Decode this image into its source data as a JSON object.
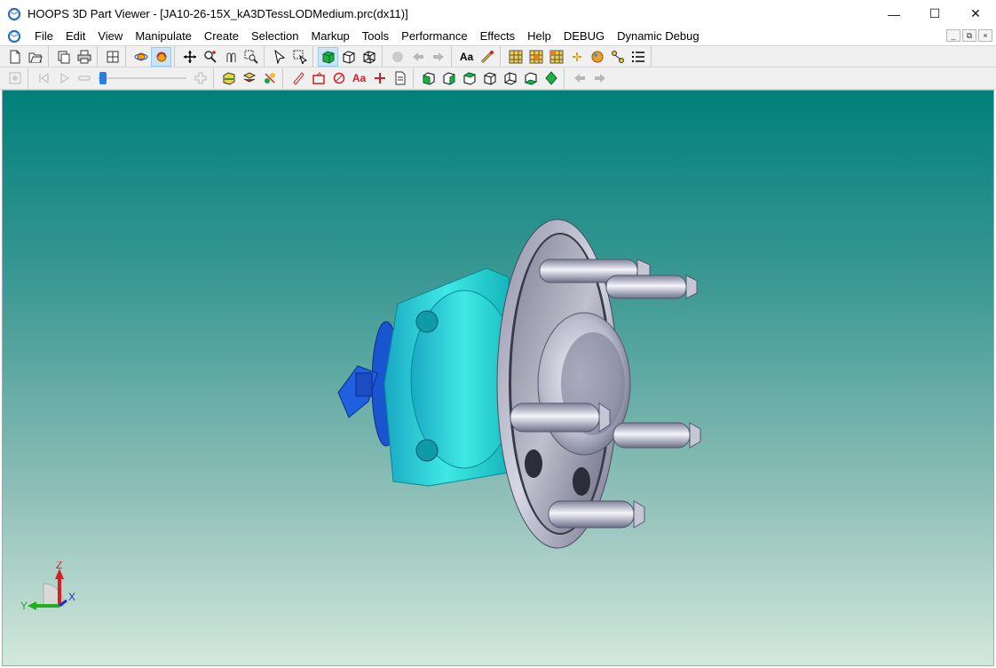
{
  "window": {
    "title": "HOOPS 3D Part Viewer - [JA10-26-15X_kA3DTessLODMedium.prc(dx11)]",
    "controls": [
      "—",
      "☐",
      "✕"
    ]
  },
  "menu": {
    "items": [
      "File",
      "Edit",
      "View",
      "Manipulate",
      "Create",
      "Selection",
      "Markup",
      "Tools",
      "Performance",
      "Effects",
      "Help",
      "DEBUG",
      "Dynamic Debug"
    ],
    "mdi_controls": [
      "_",
      "⧉",
      "×"
    ]
  },
  "toolbar": {
    "text_button": "Aa",
    "markup_text_button": "Aa",
    "animation_slider_value": 0.02
  },
  "triad": {
    "z_label": "Z",
    "x_label": "X",
    "y_label": "Y"
  },
  "colors": {
    "viewport_top": "#00807a",
    "viewport_bottom": "#d3e8dd",
    "part_cyan": "#19d6d6",
    "part_flange": "#a5a7b8",
    "axis_z": "#d42020",
    "axis_y": "#20b020",
    "axis_x": "#2030c0"
  }
}
